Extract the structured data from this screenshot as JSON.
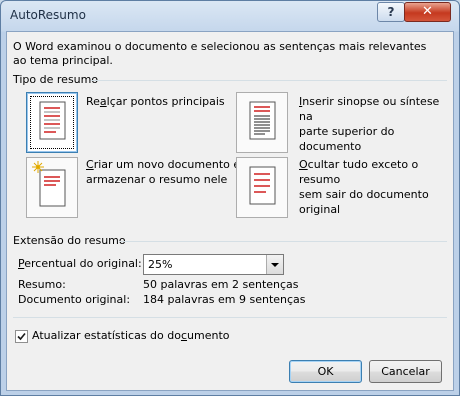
{
  "window": {
    "title": "AutoResumo",
    "help_label": "?",
    "close_label": "✕"
  },
  "intro": "O Word examinou o documento e selecionou as sentenças mais relevantes ao tema principal.",
  "summary_type": {
    "label": "Tipo de resumo",
    "options": [
      {
        "line1_pre": "Re",
        "line1_key": "a",
        "line1_post": "lçar pontos principais",
        "line2": ""
      },
      {
        "line1_pre": "",
        "line1_key": "I",
        "line1_post": "nserir sinopse ou síntese na",
        "line2": "parte superior do documento"
      },
      {
        "line1_pre": "",
        "line1_key": "C",
        "line1_post": "riar um novo documento e",
        "line2": "armazenar o resumo nele"
      },
      {
        "line1_pre": "",
        "line1_key": "O",
        "line1_post": "cultar tudo exceto o resumo",
        "line2": "sem sair do documento original"
      }
    ]
  },
  "length": {
    "label": "Extensão do resumo",
    "percent_label_key": "P",
    "percent_label_rest": "ercentual do original:",
    "percent_value": "25%",
    "summary_label": "Resumo:",
    "summary_value": "50 palavras em 2 sentenças",
    "original_label": "Documento original:",
    "original_value": "184 palavras em 9 sentenças"
  },
  "update_stats": {
    "checked": true,
    "label_pre": "Atualizar estatísticas do do",
    "label_key": "c",
    "label_post": "umento"
  },
  "buttons": {
    "ok": "OK",
    "cancel": "Cancelar"
  }
}
